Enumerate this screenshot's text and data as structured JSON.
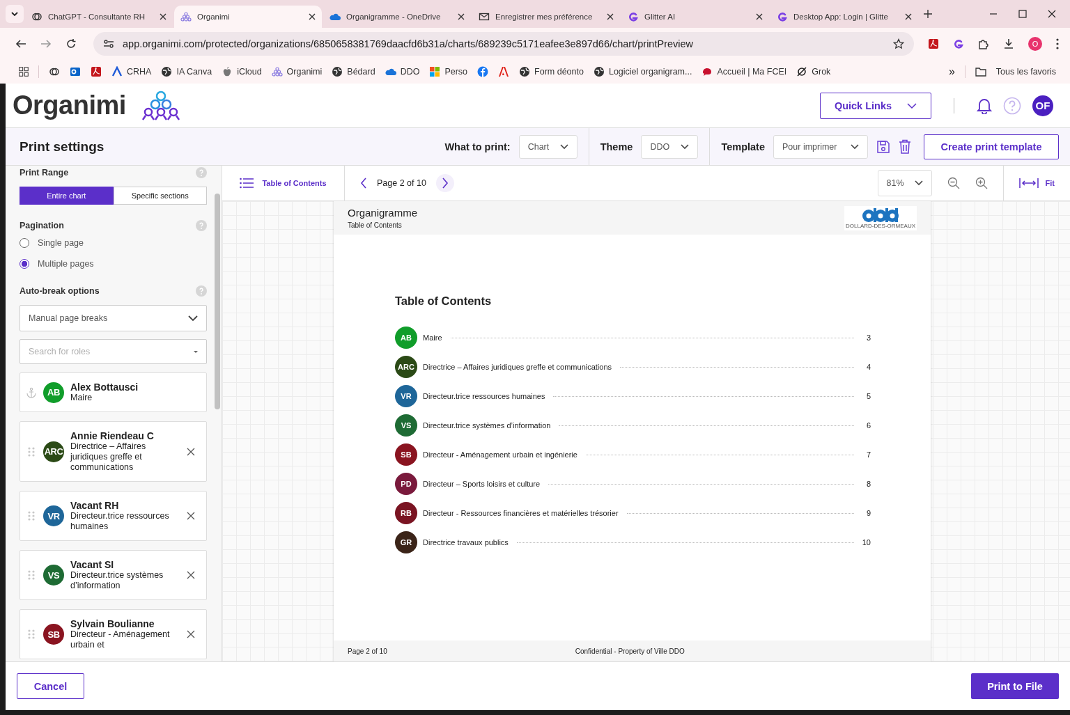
{
  "browser": {
    "tabs": [
      {
        "title": "ChatGPT - Consultante RH",
        "kind": "knot",
        "selected": false
      },
      {
        "title": "Organimi",
        "kind": "pyramid",
        "selected": true
      },
      {
        "title": "Organigramme - OneDrive",
        "kind": "cloud",
        "selected": false
      },
      {
        "title": "Enregistrer mes préférence",
        "kind": "envelope",
        "selected": false
      },
      {
        "title": "Glitter AI",
        "kind": "swirl",
        "selected": false
      },
      {
        "title": "Desktop App: Login | Glitte",
        "kind": "swirl",
        "selected": false
      }
    ],
    "url": "app.organimi.com/protected/organizations/6850658381769daacfd6b31a/charts/689239c5171eafee3e897d66/chart/printPreview",
    "profile": "O",
    "bookmarks": [
      {
        "kind": "knot"
      },
      {
        "kind": "outlook"
      },
      {
        "kind": "pdf"
      },
      {
        "label": "CRHA",
        "kind": "peak"
      },
      {
        "label": "IA Canva",
        "kind": "globe"
      },
      {
        "label": "iCloud",
        "kind": "apple"
      },
      {
        "label": "Organimi",
        "kind": "pyramid"
      },
      {
        "label": "Bédard",
        "kind": "globe"
      },
      {
        "label": "DDO",
        "kind": "cloud"
      },
      {
        "label": "Perso",
        "kind": "squares"
      },
      {
        "kind": "fcircle"
      },
      {
        "kind": "triangle"
      },
      {
        "label": "Form déonto",
        "kind": "globe"
      },
      {
        "label": "Logiciel organigram...",
        "kind": "globe"
      },
      {
        "label": "Accueil | Ma FCEI",
        "kind": "brain"
      },
      {
        "label": "Grok",
        "kind": "slashcircle"
      }
    ],
    "more": "»",
    "all_bookmarks": "Tous les favoris"
  },
  "app": {
    "logo": "Organimi",
    "quick_links": "Quick Links",
    "avatar": "OF"
  },
  "print_settings": {
    "title": "Print settings",
    "what_to_print": {
      "label": "What to print:",
      "value": "Chart"
    },
    "theme": {
      "label": "Theme",
      "value": "DDO"
    },
    "template": {
      "label": "Template",
      "value": "Pour imprimer"
    },
    "create_button": "Create print template"
  },
  "sidebar": {
    "print_range": {
      "label": "Print Range",
      "options": [
        {
          "label": "Entire chart",
          "selected": true
        },
        {
          "label": "Specific sections",
          "selected": false
        }
      ]
    },
    "pagination": {
      "label": "Pagination",
      "options": [
        {
          "label": "Single page",
          "selected": false
        },
        {
          "label": "Multiple pages",
          "selected": true
        }
      ]
    },
    "auto_break": {
      "label": "Auto-break options",
      "value": "Manual page breaks"
    },
    "search": {
      "placeholder": "Search for roles"
    },
    "roles": [
      {
        "initials": "AB",
        "color": "#109d2a",
        "name": "Alex Bottausci",
        "title": "Maire",
        "pinned": true
      },
      {
        "initials": "ARC",
        "color": "#2b4a16",
        "name": "Annie Riendeau C",
        "title": "Directrice – Affaires juridiques greffe et communications",
        "pinned": false
      },
      {
        "initials": "VR",
        "color": "#1e6699",
        "name": "Vacant RH",
        "title": "Directeur.trice ressources humaines",
        "pinned": false
      },
      {
        "initials": "VS",
        "color": "#1e6b34",
        "name": "Vacant SI",
        "title": "Directeur.trice systèmes d’information",
        "pinned": false
      },
      {
        "initials": "SB",
        "color": "#8a1420",
        "name": "Sylvain Boulianne",
        "title": "Directeur - Aménagement urbain et",
        "pinned": false
      }
    ]
  },
  "preview": {
    "toc_button": "Table of Contents",
    "page_indicator": "Page 2 of 10",
    "zoom": "81%",
    "fit": "Fit",
    "page": {
      "title": "Organigramme",
      "subtitle": "Table of Contents",
      "logo_caption": "DOLLARD-DES-ORMEAUX",
      "heading": "Table of Contents",
      "entries": [
        {
          "initials": "AB",
          "color": "#109d2a",
          "label": "Maire",
          "page": "3"
        },
        {
          "initials": "ARC",
          "color": "#2b4a16",
          "label": "Directrice – Affaires juridiques greffe et communications",
          "page": "4"
        },
        {
          "initials": "VR",
          "color": "#1e6699",
          "label": "Directeur.trice ressources humaines",
          "page": "5"
        },
        {
          "initials": "VS",
          "color": "#1e6b34",
          "label": "Directeur.trice systèmes d’information",
          "page": "6"
        },
        {
          "initials": "SB",
          "color": "#8a1420",
          "label": "Directeur - Aménagement urbain et ingénierie",
          "page": "7"
        },
        {
          "initials": "PD",
          "color": "#7a1a3c",
          "label": "Directeur – Sports loisirs et culture",
          "page": "8"
        },
        {
          "initials": "RB",
          "color": "#7a1422",
          "label": "Directeur - Ressources financières et matérielles trésorier",
          "page": "9"
        },
        {
          "initials": "GR",
          "color": "#3b2418",
          "label": "Directrice travaux publics",
          "page": "10"
        }
      ],
      "footer_page": "Page 2 of 10",
      "footer_note": "Confidential - Property of Ville DDO"
    }
  },
  "footer": {
    "cancel": "Cancel",
    "print": "Print to File"
  }
}
